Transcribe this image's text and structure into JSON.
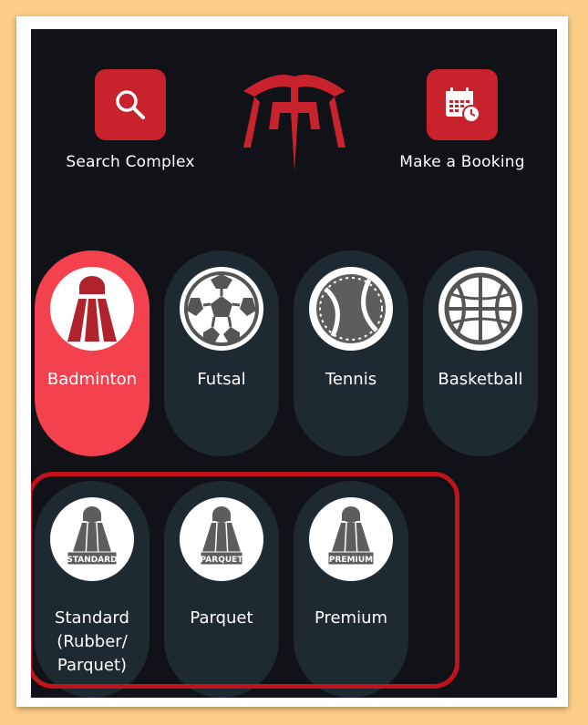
{
  "header": {
    "search_label": "Search Complex",
    "booking_label": "Make a Booking"
  },
  "sports": [
    {
      "label": "Badminton",
      "icon": "shuttlecock-icon",
      "active": true
    },
    {
      "label": "Futsal",
      "icon": "soccer-ball-icon",
      "active": false
    },
    {
      "label": "Tennis",
      "icon": "tennis-ball-icon",
      "active": false
    },
    {
      "label": "Basketball",
      "icon": "basketball-icon",
      "active": false
    }
  ],
  "court_types": [
    {
      "label": "Standard (Rubber/ Parquet)",
      "badge": "STANDARD",
      "icon": "shuttlecock-standard-icon"
    },
    {
      "label": "Parquet",
      "badge": "PARQUET",
      "icon": "shuttlecock-parquet-icon"
    },
    {
      "label": "Premium",
      "badge": "PREMIUM",
      "icon": "shuttlecock-premium-icon"
    }
  ],
  "colors": {
    "brand_red": "#c8222c",
    "active_pill": "#f4414e",
    "pill_bg": "#1e2a31",
    "screen_bg": "#101217",
    "highlight_border": "#c1131c"
  }
}
